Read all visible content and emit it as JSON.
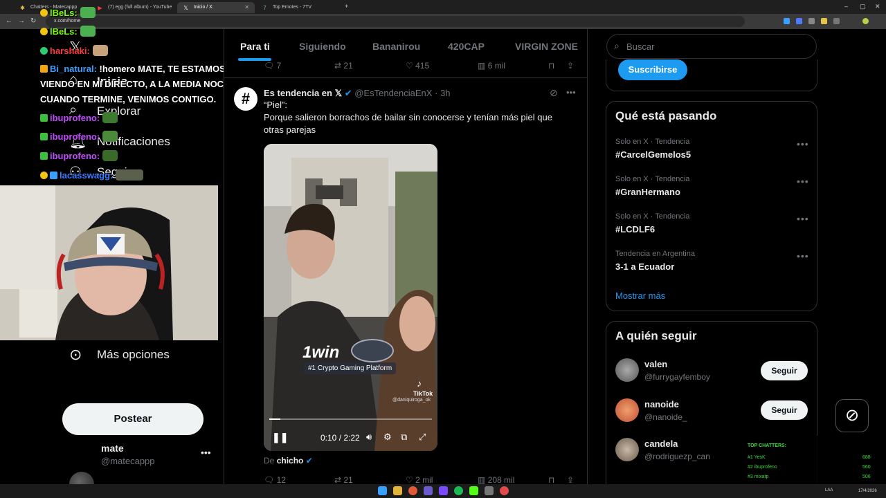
{
  "browser": {
    "tabs": [
      {
        "title": "Chatters - Matecappp",
        "favicon": "chat-icon"
      },
      {
        "title": "(7) egg (full album) - YouTube",
        "favicon": "youtube-icon"
      },
      {
        "title": "Inicio / X",
        "favicon": "x-icon"
      },
      {
        "title": "Top Emotes - 7TV",
        "favicon": "7tv-icon"
      }
    ],
    "url": "x.com/home",
    "taskbar_lang": "LAA",
    "taskbar_date": "17/4/2026"
  },
  "chat": {
    "lines": [
      {
        "user": "lBeLs:",
        "message": "",
        "color": "#7cfc00"
      },
      {
        "user": "lBeLs:",
        "message": "",
        "color": "#7cfc00"
      },
      {
        "user": "harshaki:",
        "message": "",
        "color": "#ff3b3b"
      },
      {
        "user": "Bi_natural:",
        "message": "!homero MATE, TE ESTAMOS",
        "color": "#3aa0ff"
      },
      {
        "user": "",
        "message": "VIENDO EN MI DIRECTO, A LA MEDIA NOCHE",
        "color": "#fff"
      },
      {
        "user": "",
        "message": "CUANDO TERMINE, VENIMOS CONTIGO.",
        "color": "#fff"
      },
      {
        "user": "ibuprofeno:",
        "message": "",
        "color": "#c04bff"
      },
      {
        "user": "ibuprofeno:",
        "message": "",
        "color": "#c04bff"
      },
      {
        "user": "ibuprofeno:",
        "message": "",
        "color": "#c04bff"
      },
      {
        "user": "lacasswagg:",
        "message": "",
        "color": "#3a7bff"
      }
    ]
  },
  "sidebar": {
    "items": [
      {
        "label": "Inicio",
        "icon": "home-icon"
      },
      {
        "label": "Explorar",
        "icon": "search-icon"
      },
      {
        "label": "Notificaciones",
        "icon": "bell-icon"
      },
      {
        "label": "Seguir",
        "icon": "add-user-icon"
      }
    ],
    "more_label": "Más opciones",
    "post_label": "Postear",
    "account": {
      "name": "mate",
      "handle": "@matecappp"
    }
  },
  "feed": {
    "tabs": [
      "Para ti",
      "Siguiendo",
      "Bananirou",
      "420CAP",
      "VIRGIN ZONE"
    ],
    "prev_actions": {
      "replies": "7",
      "reposts": "21",
      "likes": "415",
      "views": "6 mil"
    },
    "post": {
      "author": "Es tendencia en",
      "handle": "@EsTendenciaEnX",
      "time": "3h",
      "line1": "“Piel”:",
      "line2": "Porque salieron borrachos de bailar sin conocerse y tenían más piel que",
      "line3": "otras parejas",
      "video": {
        "overlay_brand": "1win",
        "overlay_sub": "#1 Crypto Gaming Platform",
        "tiktok": "TikTok",
        "tiktok_user": "@daniquiroga_ok",
        "time": "0:10 / 2:22",
        "progress": 0.07
      },
      "from_label": "De",
      "from_user": "chicho",
      "actions": {
        "replies": "12",
        "reposts": "21",
        "likes": "2 mil",
        "views": "208 mil"
      }
    }
  },
  "right": {
    "search_placeholder": "Buscar",
    "subscribe_label": "Suscribirse",
    "trends_title": "Qué está pasando",
    "trends": [
      {
        "meta": "Solo en X · Tendencia",
        "name": "#CarcelGemelos5"
      },
      {
        "meta": "Solo en X · Tendencia",
        "name": "#GranHermano"
      },
      {
        "meta": "Solo en X · Tendencia",
        "name": "#LCDLF6"
      },
      {
        "meta": "Tendencia en Argentina",
        "name": "3-1 a Ecuador"
      }
    ],
    "show_more": "Mostrar más",
    "follow_title": "A quién seguir",
    "follow": [
      {
        "name": "valen",
        "handle": "@furrygayfemboy",
        "button": "Seguir"
      },
      {
        "name": "nanoide",
        "handle": "@nanoide_",
        "button": "Seguir"
      },
      {
        "name": "candela",
        "handle": "@rodriguezp_can",
        "button": ""
      }
    ]
  },
  "top_chatters": {
    "title": "TOP CHATTERS:",
    "rows": [
      {
        "rank": "#1 YesK",
        "count": "688"
      },
      {
        "rank": "#2 ibuprofeno",
        "count": "560"
      },
      {
        "rank": "#3 mixatp",
        "count": "506"
      }
    ]
  }
}
